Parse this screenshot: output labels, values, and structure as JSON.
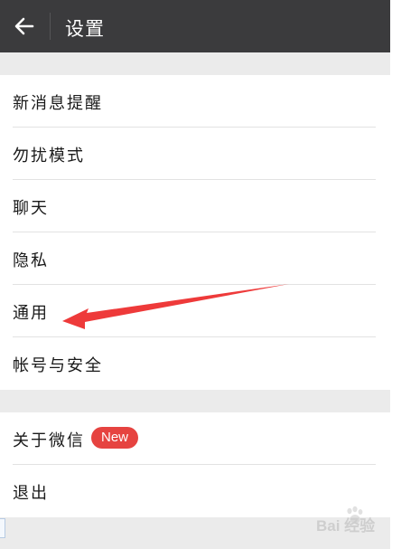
{
  "header": {
    "title": "设置"
  },
  "groups": [
    {
      "items": [
        {
          "label": "新消息提醒"
        },
        {
          "label": "勿扰模式"
        },
        {
          "label": "聊天"
        },
        {
          "label": "隐私"
        },
        {
          "label": "通用"
        },
        {
          "label": "帐号与安全"
        }
      ]
    },
    {
      "items": [
        {
          "label": "关于微信",
          "badge": "New"
        },
        {
          "label": "退出"
        }
      ]
    }
  ],
  "watermark": {
    "text": "Bai 经验"
  },
  "colors": {
    "header_bg": "#3b3b3d",
    "page_bg": "#ebebeb",
    "badge_bg": "#e64340",
    "annotation_arrow": "#ee3a3a"
  },
  "icons": {
    "back": "arrow-left-icon",
    "annotation": "red-annotation-arrow"
  }
}
